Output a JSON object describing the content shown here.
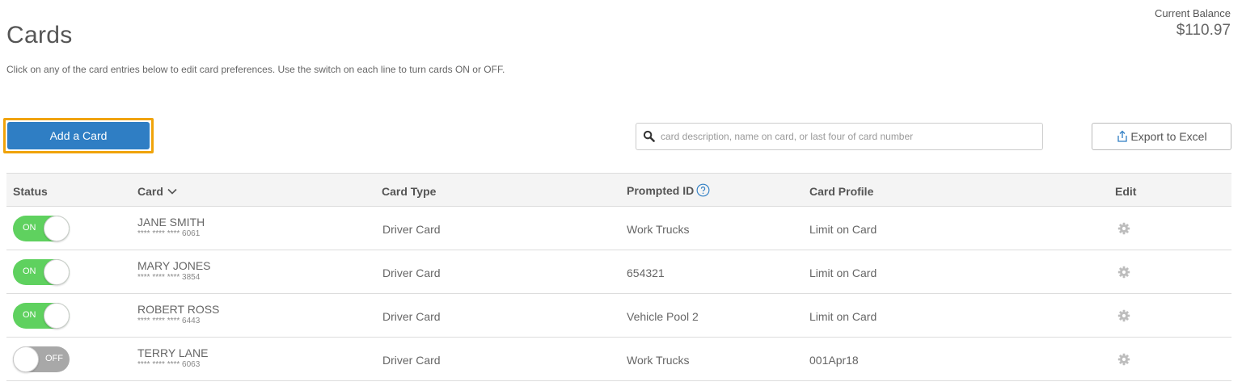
{
  "header": {
    "title": "Cards",
    "subtitle": "Click on any of the card entries below to edit card preferences. Use the switch on each line to turn cards ON or OFF.",
    "balance_label": "Current Balance",
    "balance_value": "$110.97"
  },
  "toolbar": {
    "add_label": "Add a Card",
    "search_placeholder": "card description, name on card, or last four of card number",
    "search_value": "",
    "export_label": "Export to Excel",
    "search_icon": "search-icon",
    "export_icon": "upload-icon"
  },
  "colors": {
    "primary": "#2f7ec4",
    "highlight": "#f0a30a",
    "toggle_on": "#5fd15f",
    "toggle_off": "#a8a8a8"
  },
  "table": {
    "columns": [
      "Status",
      "Card",
      "Card Type",
      "Prompted ID",
      "Card Profile",
      "Edit"
    ],
    "sort_icon": "chevron-down-icon",
    "help_icon": "help-icon",
    "edit_icon": "gear-icon",
    "rows": [
      {
        "status": "ON",
        "name": "JANE SMITH",
        "number": "**** **** **** 6061",
        "type": "Driver Card",
        "prompted": "Work Trucks",
        "profile": "Limit on Card"
      },
      {
        "status": "ON",
        "name": "MARY JONES",
        "number": "**** **** **** 3854",
        "type": "Driver Card",
        "prompted": "654321",
        "profile": "Limit on Card"
      },
      {
        "status": "ON",
        "name": "ROBERT ROSS",
        "number": "**** **** **** 6443",
        "type": "Driver Card",
        "prompted": "Vehicle Pool 2",
        "profile": "Limit on Card"
      },
      {
        "status": "OFF",
        "name": "TERRY LANE",
        "number": "**** **** **** 6063",
        "type": "Driver Card",
        "prompted": "Work Trucks",
        "profile": "001Apr18"
      }
    ]
  }
}
